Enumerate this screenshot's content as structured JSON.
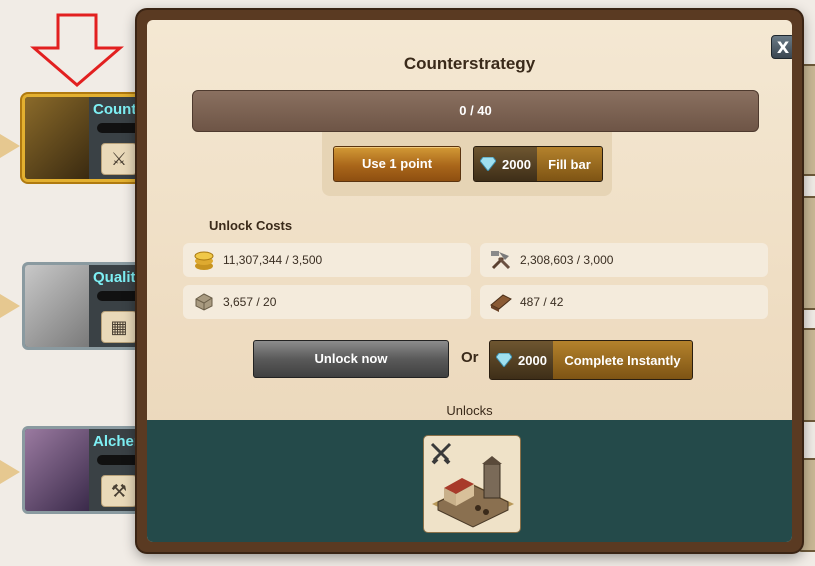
{
  "background": {
    "nodes": [
      {
        "title": "Count",
        "icon": "crossed-swords-icon"
      },
      {
        "title": "Qualit",
        "icon": "bricks-icon"
      },
      {
        "title": "Alcher",
        "icon": "hammer-icon"
      }
    ]
  },
  "modal": {
    "title": "Counterstrategy",
    "close_label": "X",
    "progress": {
      "text": "0 / 40",
      "current": 0,
      "max": 40
    },
    "use_point_label": "Use 1 point",
    "fill_bar": {
      "cost": "2000",
      "label": "Fill bar"
    },
    "unlock_costs_label": "Unlock Costs",
    "costs": [
      {
        "icon": "coins-icon",
        "text": "11,307,344 / 3,500"
      },
      {
        "icon": "tools-icon",
        "text": "2,308,603 / 3,000"
      },
      {
        "icon": "stone-icon",
        "text": "3,657 / 20"
      },
      {
        "icon": "lumber-icon",
        "text": "487 / 42"
      }
    ],
    "unlock_now_label": "Unlock now",
    "or_label": "Or",
    "complete_instantly": {
      "cost": "2000",
      "label": "Complete Instantly"
    },
    "unlocks_label": "Unlocks",
    "unlock_item": {
      "icon": "crossed-swords-icon",
      "image": "barracks-building"
    }
  },
  "colors": {
    "accent_gold": "#b8862a",
    "teal_panel": "#244a4a",
    "node_title": "#7ef0f5"
  }
}
